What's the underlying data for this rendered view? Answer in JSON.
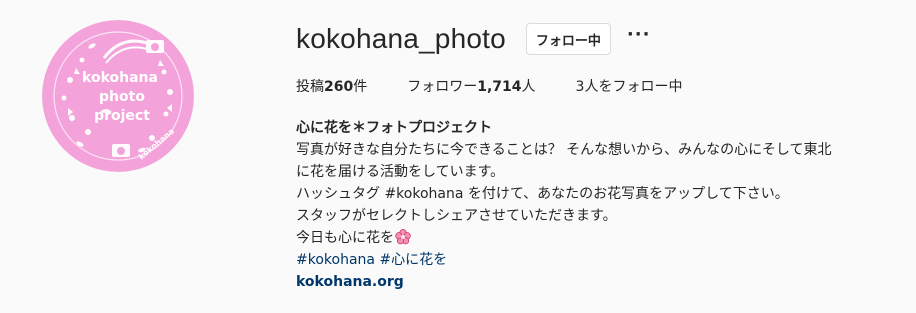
{
  "profile": {
    "username": "kokohana_photo",
    "follow_label": "フォロー中",
    "more_label": "···",
    "avatar": {
      "line1": "kokohana",
      "line2": "photo",
      "line3": "project",
      "ring_text": "kokohana",
      "bg_color": "#f3a3da"
    }
  },
  "stats": {
    "posts_prefix": "投稿",
    "posts_count": "260",
    "posts_suffix": "件",
    "followers_prefix": "フォロワー",
    "followers_count": "1,714",
    "followers_suffix": "人",
    "following_text": "3人をフォロー中"
  },
  "bio": {
    "name": "心に花を＊フォトプロジェクト",
    "line1": "写真が好きな自分たちに今できることは？ そんな想いから、みんなの心にそして東北",
    "line2": "に花を届ける活動をしています。",
    "line3": "ハッシュタグ #kokohana を付けて、あなたのお花写真をアップして下さい。",
    "line4": "スタッフがセレクトしシェアさせていただきます。",
    "line5": "今日も心に花を",
    "hashtags": "#kokohana #心に花を",
    "website": "kokohana.org",
    "flower_icon": "cherry-blossom-icon"
  }
}
